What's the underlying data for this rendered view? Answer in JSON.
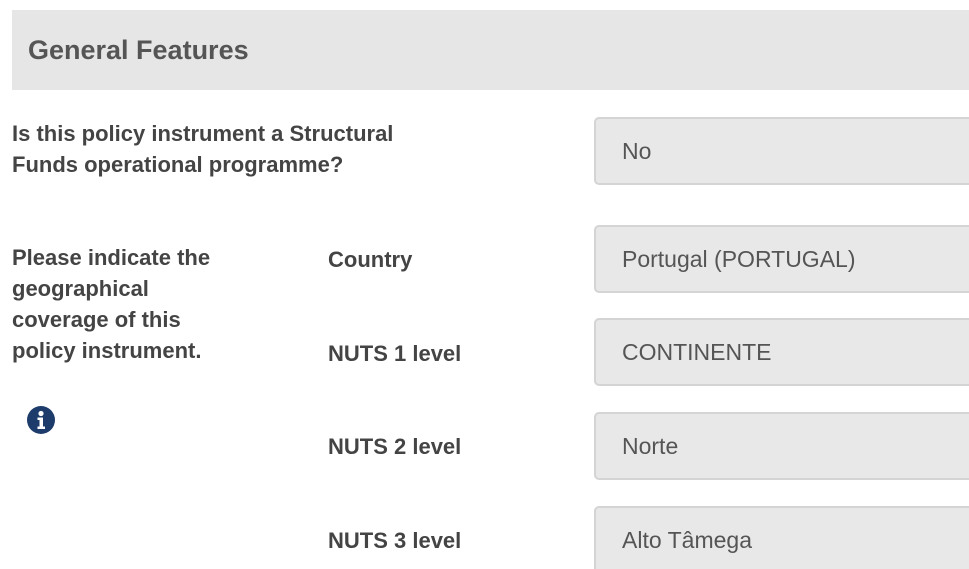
{
  "section": {
    "title": "General Features"
  },
  "structural_funds": {
    "question_line1": "Is this policy instrument a Structural",
    "question_line2": "Funds operational programme?",
    "value": "No"
  },
  "coverage": {
    "question_lines": [
      "Please indicate the",
      "geographical",
      "coverage of this",
      "policy instrument."
    ],
    "info_icon": "info-circle-icon",
    "rows": [
      {
        "label": "Country",
        "value": "Portugal (PORTUGAL)"
      },
      {
        "label": "NUTS 1 level",
        "value": "CONTINENTE"
      },
      {
        "label": "NUTS 2 level",
        "value": "Norte"
      },
      {
        "label": "NUTS 3 level",
        "value": "Alto Tâmega"
      }
    ]
  },
  "colors": {
    "header_bg": "#e6e6e6",
    "field_bg": "#e8e8e8",
    "field_border": "#d4d4d4",
    "label_text": "#444444",
    "info_icon": "#1d3c6b"
  }
}
